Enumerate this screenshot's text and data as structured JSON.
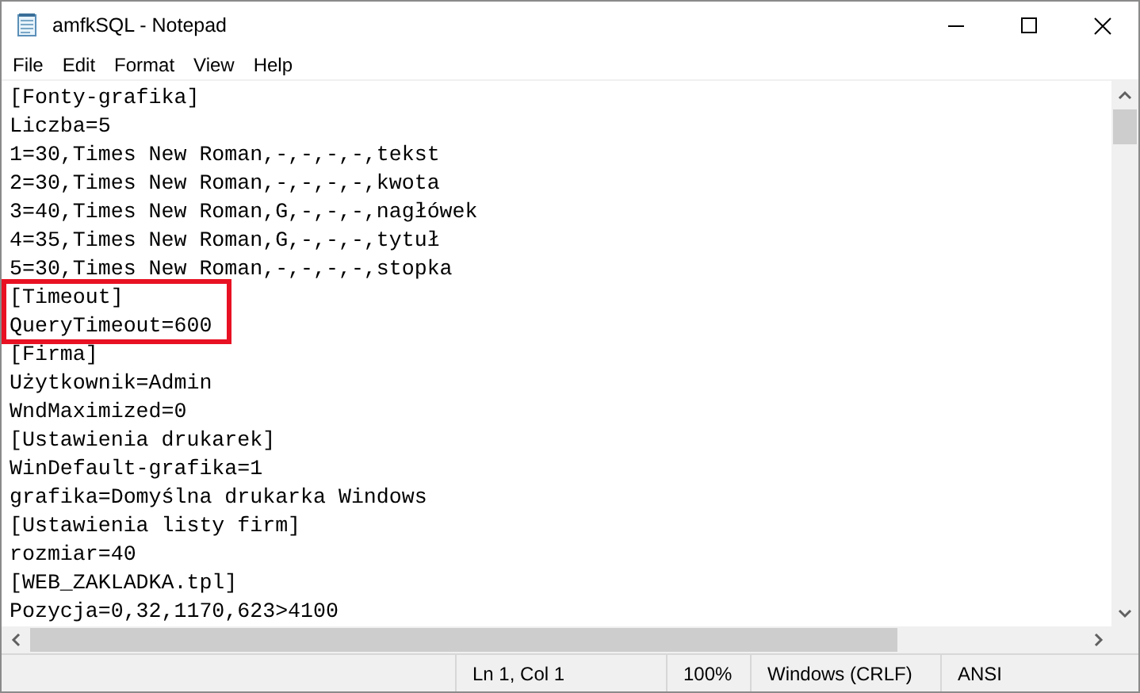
{
  "window": {
    "title": "amfkSQL - Notepad"
  },
  "menu": [
    "File",
    "Edit",
    "Format",
    "View",
    "Help"
  ],
  "editor": {
    "lines": [
      {
        "text": "[Fonty-grafika]",
        "highlighted": false
      },
      {
        "text": "Liczba=5",
        "highlighted": false
      },
      {
        "text": "1=30,Times New Roman,-,-,-,-,tekst",
        "highlighted": false
      },
      {
        "text": "2=30,Times New Roman,-,-,-,-,kwota",
        "highlighted": false
      },
      {
        "text": "3=40,Times New Roman,G,-,-,-,nagłówek",
        "highlighted": false
      },
      {
        "text": "4=35,Times New Roman,G,-,-,-,tytuł",
        "highlighted": false
      },
      {
        "text": "5=30,Times New Roman,-,-,-,-,stopka",
        "highlighted": false
      },
      {
        "text": "[Timeout]",
        "highlighted": true
      },
      {
        "text": "QueryTimeout=600",
        "highlighted": true
      },
      {
        "text": "[Firma]",
        "highlighted": false
      },
      {
        "text": "Użytkownik=Admin",
        "highlighted": false
      },
      {
        "text": "WndMaximized=0",
        "highlighted": false
      },
      {
        "text": "[Ustawienia drukarek]",
        "highlighted": false
      },
      {
        "text": "WinDefault-grafika=1",
        "highlighted": false
      },
      {
        "text": "grafika=Domyślna drukarka Windows",
        "highlighted": false
      },
      {
        "text": "[Ustawienia listy firm]",
        "highlighted": false
      },
      {
        "text": "rozmiar=40",
        "highlighted": false
      },
      {
        "text": "[WEB_ZAKLADKA.tpl]",
        "highlighted": false
      },
      {
        "text": "Pozycja=0,32,1170,623>4100",
        "highlighted": false
      }
    ]
  },
  "status_bar": [
    "Ln 1, Col 1",
    "100%",
    "Windows (CRLF)",
    "ANSI"
  ]
}
